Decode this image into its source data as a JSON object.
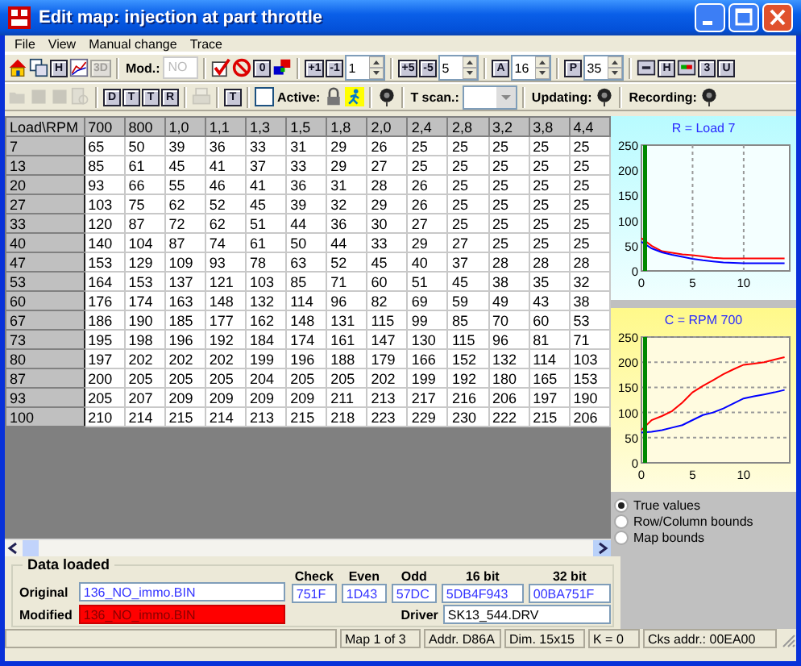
{
  "window": {
    "title": "Edit map: injection at part throttle"
  },
  "menu": [
    "File",
    "View",
    "Manual change",
    "Trace"
  ],
  "toolbar_1": [
    {
      "kind": "icon",
      "disabled": false
    },
    {
      "kind": "icon",
      "disabled": false
    },
    {
      "kind": "letter",
      "text": "H",
      "disabled": false
    },
    {
      "kind": "icon",
      "disabled": false
    },
    {
      "kind": "letter",
      "text": "3D",
      "disabled": true
    },
    {
      "kind": "separator"
    },
    {
      "kind": "label",
      "text": "Mod.:"
    },
    {
      "kind": "field",
      "value": "NO",
      "disabled": true
    },
    {
      "kind": "separator"
    },
    {
      "kind": "icon",
      "disabled": false
    },
    {
      "kind": "icon",
      "disabled": false
    },
    {
      "kind": "letter",
      "text": "0",
      "disabled": false
    },
    {
      "kind": "icon",
      "disabled": false
    },
    {
      "kind": "separator"
    },
    {
      "kind": "letter",
      "text": "+1",
      "disabled": false
    },
    {
      "kind": "letter",
      "text": "-1",
      "disabled": false
    },
    {
      "kind": "spin",
      "value": "1"
    },
    {
      "kind": "separator"
    },
    {
      "kind": "letter",
      "text": "+5",
      "disabled": false
    },
    {
      "kind": "letter",
      "text": "-5",
      "disabled": false
    },
    {
      "kind": "spin",
      "value": "5"
    },
    {
      "kind": "separator"
    },
    {
      "kind": "letter",
      "text": "A",
      "disabled": false
    },
    {
      "kind": "spin",
      "value": "16"
    },
    {
      "kind": "separator"
    },
    {
      "kind": "letter",
      "text": "P",
      "disabled": false
    },
    {
      "kind": "spin",
      "value": "35"
    },
    {
      "kind": "separator"
    },
    {
      "kind": "icon",
      "disabled": false
    },
    {
      "kind": "letter",
      "text": "H",
      "disabled": false
    },
    {
      "kind": "icon",
      "disabled": false
    },
    {
      "kind": "letter",
      "text": "3",
      "disabled": false
    },
    {
      "kind": "letter",
      "text": "U",
      "disabled": false
    }
  ],
  "toolbar_2": [
    {
      "kind": "icon",
      "disabled": true
    },
    {
      "kind": "icon",
      "disabled": true
    },
    {
      "kind": "icon",
      "disabled": true
    },
    {
      "kind": "icon",
      "disabled": true
    },
    {
      "kind": "separator"
    },
    {
      "kind": "letter",
      "text": "D",
      "disabled": false
    },
    {
      "kind": "letter",
      "text": "T",
      "disabled": false
    },
    {
      "kind": "letter",
      "text": "T",
      "disabled": false
    },
    {
      "kind": "letter",
      "text": "R",
      "disabled": false
    },
    {
      "kind": "separator"
    },
    {
      "kind": "icon",
      "disabled": true
    },
    {
      "kind": "separator"
    },
    {
      "kind": "letter",
      "text": "T",
      "disabled": false
    },
    {
      "kind": "separator"
    },
    {
      "kind": "checkbox",
      "text": "Active:",
      "checked": false
    },
    {
      "kind": "icon",
      "disabled": false
    },
    {
      "kind": "icon",
      "disabled": false
    },
    {
      "kind": "separator"
    },
    {
      "kind": "icon",
      "disabled": false
    },
    {
      "kind": "separator"
    },
    {
      "kind": "label",
      "text": "T scan.:"
    },
    {
      "kind": "dropdown"
    },
    {
      "kind": "separator"
    },
    {
      "kind": "label",
      "text": "Updating:"
    },
    {
      "kind": "icon",
      "disabled": false
    },
    {
      "kind": "separator"
    },
    {
      "kind": "label",
      "text": "Recording:"
    },
    {
      "kind": "icon",
      "disabled": false
    }
  ],
  "table": {
    "corner_label": "Load\\RPM",
    "columns": [
      "700",
      "800",
      "1,0",
      "1,1",
      "1,3",
      "1,5",
      "1,8",
      "2,0",
      "2,4",
      "2,8",
      "3,2",
      "3,8",
      "4,4"
    ],
    "rows": [
      {
        "label": "7",
        "cells": [
          "65",
          "50",
          "39",
          "36",
          "33",
          "31",
          "29",
          "26",
          "25",
          "25",
          "25",
          "25",
          "25"
        ]
      },
      {
        "label": "13",
        "cells": [
          "85",
          "61",
          "45",
          "41",
          "37",
          "33",
          "29",
          "27",
          "25",
          "25",
          "25",
          "25",
          "25"
        ]
      },
      {
        "label": "20",
        "cells": [
          "93",
          "66",
          "55",
          "46",
          "41",
          "36",
          "31",
          "28",
          "26",
          "25",
          "25",
          "25",
          "25"
        ]
      },
      {
        "label": "27",
        "cells": [
          "103",
          "75",
          "62",
          "52",
          "45",
          "39",
          "32",
          "29",
          "26",
          "25",
          "25",
          "25",
          "25"
        ]
      },
      {
        "label": "33",
        "cells": [
          "120",
          "87",
          "72",
          "62",
          "51",
          "44",
          "36",
          "30",
          "27",
          "25",
          "25",
          "25",
          "25"
        ]
      },
      {
        "label": "40",
        "cells": [
          "140",
          "104",
          "87",
          "74",
          "61",
          "50",
          "44",
          "33",
          "29",
          "27",
          "25",
          "25",
          "25"
        ]
      },
      {
        "label": "47",
        "cells": [
          "153",
          "129",
          "109",
          "93",
          "78",
          "63",
          "52",
          "45",
          "40",
          "37",
          "28",
          "28",
          "28"
        ]
      },
      {
        "label": "53",
        "cells": [
          "164",
          "153",
          "137",
          "121",
          "103",
          "85",
          "71",
          "60",
          "51",
          "45",
          "38",
          "35",
          "32"
        ]
      },
      {
        "label": "60",
        "cells": [
          "176",
          "174",
          "163",
          "148",
          "132",
          "114",
          "96",
          "82",
          "69",
          "59",
          "49",
          "43",
          "38"
        ]
      },
      {
        "label": "67",
        "cells": [
          "186",
          "190",
          "185",
          "177",
          "162",
          "148",
          "131",
          "115",
          "99",
          "85",
          "70",
          "60",
          "53"
        ]
      },
      {
        "label": "73",
        "cells": [
          "195",
          "198",
          "196",
          "192",
          "184",
          "174",
          "161",
          "147",
          "130",
          "115",
          "96",
          "81",
          "71"
        ]
      },
      {
        "label": "80",
        "cells": [
          "197",
          "202",
          "202",
          "202",
          "199",
          "196",
          "188",
          "179",
          "166",
          "152",
          "132",
          "114",
          "103"
        ]
      },
      {
        "label": "87",
        "cells": [
          "200",
          "205",
          "205",
          "205",
          "204",
          "205",
          "205",
          "202",
          "199",
          "192",
          "180",
          "165",
          "153"
        ]
      },
      {
        "label": "93",
        "cells": [
          "205",
          "207",
          "209",
          "209",
          "209",
          "209",
          "211",
          "213",
          "217",
          "216",
          "206",
          "197",
          "190"
        ]
      },
      {
        "label": "100",
        "cells": [
          "210",
          "214",
          "215",
          "214",
          "213",
          "215",
          "218",
          "223",
          "229",
          "230",
          "222",
          "215",
          "206"
        ]
      }
    ]
  },
  "charts": [
    {
      "chart_data": {
        "type": "line",
        "title": "R = Load 7",
        "grid": "x",
        "x": [
          0,
          1,
          2,
          3,
          4,
          5,
          6,
          7,
          8,
          9,
          10,
          11,
          12,
          13,
          14
        ],
        "xlim": [
          0,
          14.5
        ],
        "ylim": [
          0,
          250
        ],
        "xticks": [
          0,
          5,
          10
        ],
        "yticks": [
          0,
          50,
          100,
          150,
          200,
          250
        ],
        "series": [
          {
            "color": "#ff0000",
            "values": [
              65,
              50,
              39,
              36,
              33,
              31,
              29,
              26,
              25,
              25,
              25,
              25,
              25,
              25,
              25
            ]
          },
          {
            "color": "#0000ff",
            "values": [
              58,
              45,
              37,
              32,
              28,
              24,
              21,
              19,
              17,
              16,
              15,
              15,
              15,
              15,
              15
            ]
          }
        ]
      }
    },
    {
      "chart_data": {
        "type": "line",
        "title": "C = RPM 700",
        "grid": "y",
        "x": [
          0,
          1,
          2,
          3,
          4,
          5,
          6,
          7,
          8,
          9,
          10,
          11,
          12,
          13,
          14
        ],
        "xlim": [
          0,
          14.5
        ],
        "ylim": [
          0,
          250
        ],
        "xticks": [
          0,
          5,
          10
        ],
        "yticks": [
          0,
          50,
          100,
          150,
          200,
          250
        ],
        "series": [
          {
            "color": "#ff0000",
            "values": [
              65,
              85,
              93,
              103,
              120,
              140,
              153,
              164,
              176,
              186,
              195,
              197,
              200,
              205,
              210
            ]
          },
          {
            "color": "#0000ff",
            "values": [
              60,
              62,
              65,
              70,
              75,
              85,
              95,
              100,
              108,
              118,
              128,
              132,
              136,
              140,
              145
            ]
          }
        ]
      }
    }
  ],
  "view_options": [
    {
      "label": "True values",
      "selected": true
    },
    {
      "label": "Row/Column bounds",
      "selected": false
    },
    {
      "label": "Map bounds",
      "selected": false
    }
  ],
  "data_panel": {
    "title": "Data loaded",
    "original_label": "Original",
    "original_file": "136_NO_immo.BIN",
    "modified_label": "Modified",
    "modified_file": "136_NO_immo.BIN",
    "modified_changed": true,
    "checksums": [
      {
        "label": "Check",
        "value": "751F"
      },
      {
        "label": "Even",
        "value": "1D43"
      },
      {
        "label": "Odd",
        "value": "57DC"
      },
      {
        "label": "16 bit",
        "value": "5DB4F943"
      },
      {
        "label": "32 bit",
        "value": "00BA751F"
      }
    ],
    "driver_label": "Driver",
    "driver": "SK13_544.DRV"
  },
  "status_bar": [
    "Map 1 of 3",
    "Addr. D86A",
    "Dim. 15x15",
    "K = 0",
    "Cks addr.: 00EA00"
  ]
}
